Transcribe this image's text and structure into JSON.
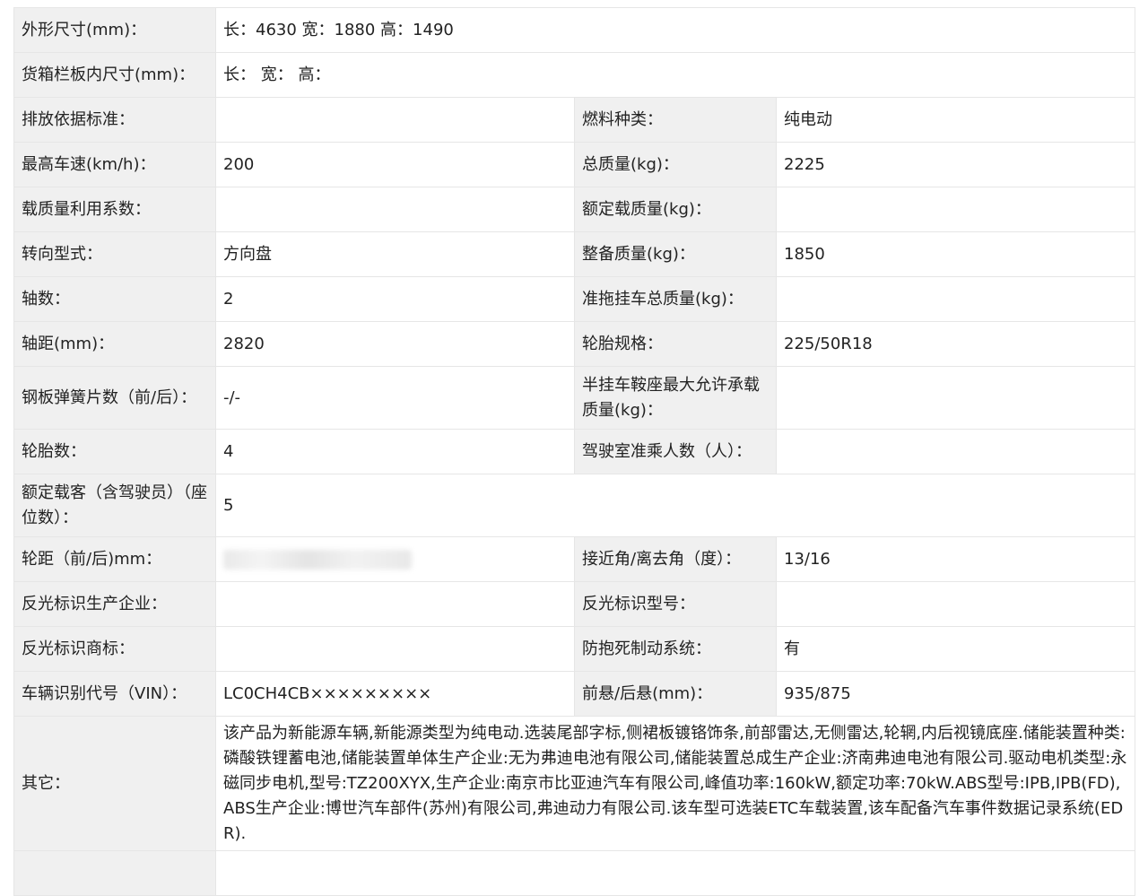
{
  "rows": [
    {
      "type": "wide",
      "label": "外形尺寸(mm)：",
      "value": "长：4630 宽：1880 高：1490"
    },
    {
      "type": "wide",
      "label": "货箱栏板内尺寸(mm)：",
      "value": "长： 宽： 高："
    },
    {
      "type": "pair",
      "l1": "排放依据标准：",
      "v1": "",
      "l2": "燃料种类：",
      "v2": "纯电动"
    },
    {
      "type": "pair",
      "l1": "最高车速(km/h)：",
      "v1": "200",
      "l2": "总质量(kg)：",
      "v2": "2225"
    },
    {
      "type": "pair",
      "l1": "载质量利用系数：",
      "v1": "",
      "l2": "额定载质量(kg)：",
      "v2": ""
    },
    {
      "type": "pair",
      "l1": "转向型式：",
      "v1": "方向盘",
      "l2": "整备质量(kg)：",
      "v2": "1850"
    },
    {
      "type": "pair",
      "l1": "轴数：",
      "v1": "2",
      "l2": "准拖挂车总质量(kg)：",
      "v2": ""
    },
    {
      "type": "pair",
      "l1": "轴距(mm)：",
      "v1": "2820",
      "l2": "轮胎规格：",
      "v2": "225/50R18"
    },
    {
      "type": "pair",
      "l1": "钢板弹簧片数（前/后）：",
      "v1": "-/-",
      "l2": "半挂车鞍座最大允许承载质量(kg)：",
      "v2": ""
    },
    {
      "type": "pair",
      "l1": "轮胎数：",
      "v1": "4",
      "l2": "驾驶室准乘人数（人）：",
      "v2": ""
    },
    {
      "type": "wide",
      "label": "额定载客（含驾驶员）（座位数）：",
      "value": "5"
    },
    {
      "type": "pair",
      "l1": "轮距（前/后)mm：",
      "v1": "",
      "l2": "接近角/离去角（度）：",
      "v2": "13/16"
    },
    {
      "type": "pair",
      "l1": "反光标识生产企业：",
      "v1": "",
      "l2": "反光标识型号：",
      "v2": ""
    },
    {
      "type": "pair",
      "l1": "反光标识商标：",
      "v1": "",
      "l2": "防抱死制动系统：",
      "v2": "有"
    },
    {
      "type": "pair",
      "l1": "车辆识别代号（VIN）：",
      "v1": "LC0CH4CB×××××××××",
      "l2": "前悬/后悬(mm)：",
      "v2": "935/875"
    },
    {
      "type": "wide",
      "label": "其它：",
      "value": "该产品为新能源车辆,新能源类型为纯电动.选装尾部字标,侧裙板镀铬饰条,前部雷达,无侧雷达,轮辋,内后视镜底座.储能装置种类:磷酸铁锂蓄电池,储能装置单体生产企业:无为弗迪电池有限公司,储能装置总成生产企业:济南弗迪电池有限公司.驱动电机类型:永磁同步电机,型号:TZ200XYX,生产企业:南京市比亚迪汽车有限公司,峰值功率:160kW,额定功率:70kW.ABS型号:IPB,IPB(FD),ABS生产企业:博世汽车部件(苏州)有限公司,弗迪动力有限公司.该车型可选装ETC车载装置,该车配备汽车事件数据记录系统(EDR)."
    }
  ]
}
